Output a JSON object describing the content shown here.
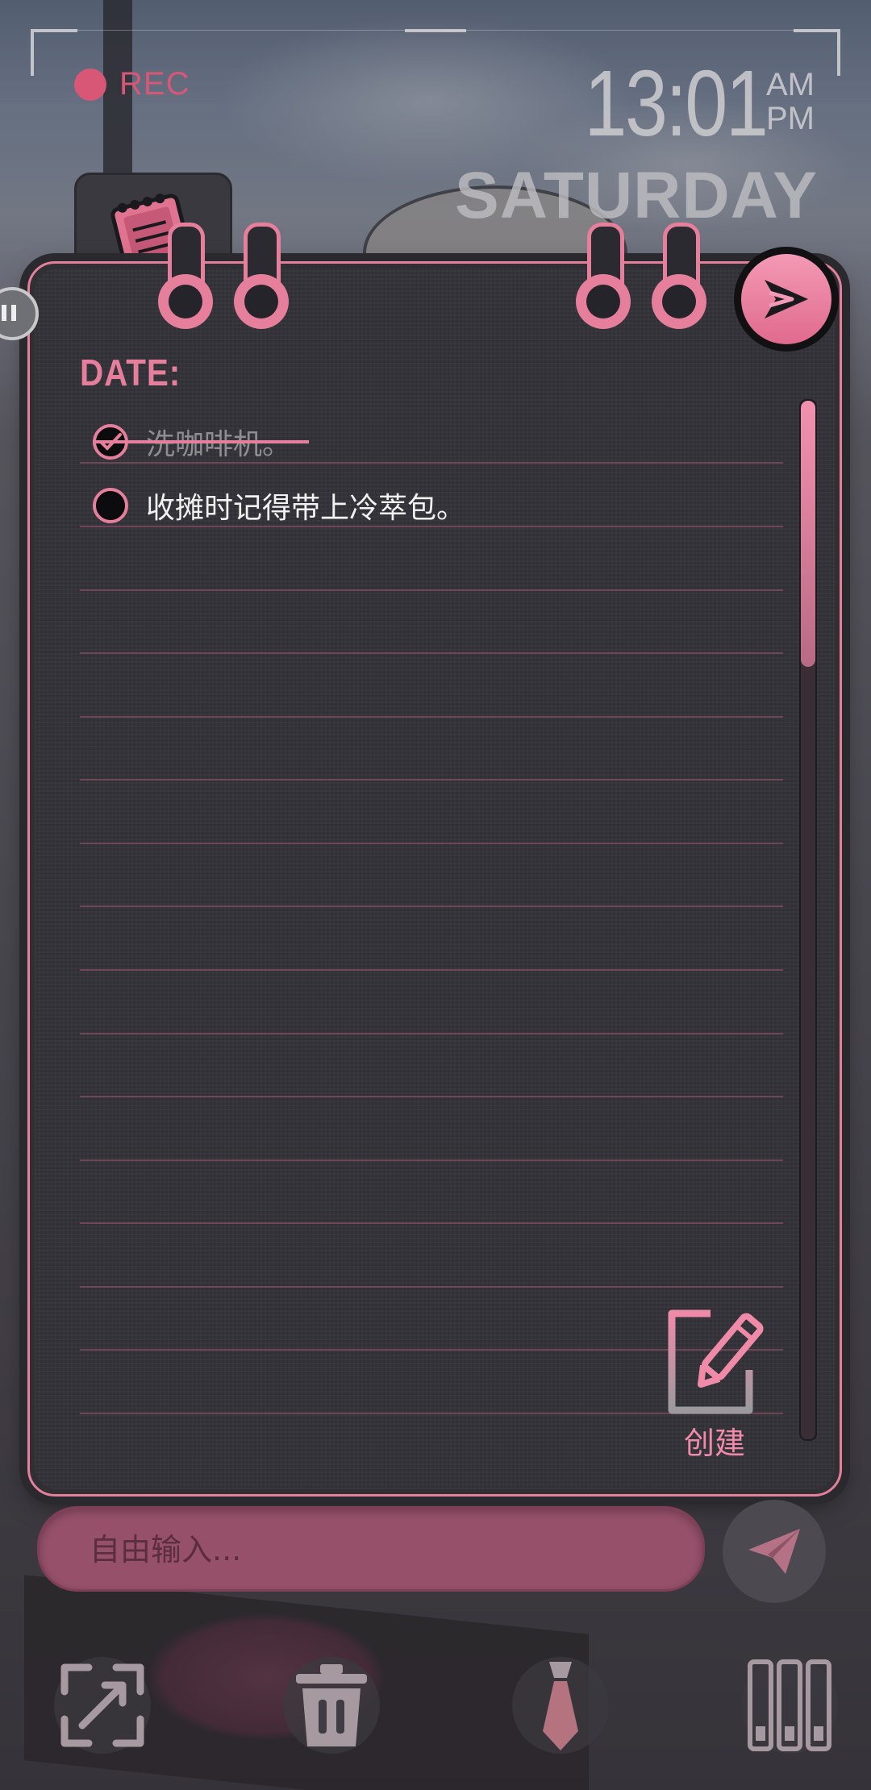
{
  "status": {
    "rec_label": "REC",
    "time": "13:01",
    "am": "AM",
    "pm": "PM",
    "weekday": "SATURDAY"
  },
  "notebook": {
    "date_label": "DATE:",
    "tasks": [
      {
        "text": "洗咖啡机。",
        "done": true
      },
      {
        "text": "收摊时记得带上冷萃包。",
        "done": false
      }
    ],
    "create_label": "创建"
  },
  "input": {
    "placeholder": "自由输入..."
  },
  "icons": {
    "send_fab": "play-send-icon",
    "create": "edit-square-icon",
    "send": "paper-plane-icon",
    "toolbar": [
      "expand-icon",
      "trash-icon",
      "tie-icon",
      "bars-icon"
    ]
  },
  "colors": {
    "accent": "#e57f9c",
    "input_bg": "#96506a",
    "notebook_bg": "#313036"
  }
}
